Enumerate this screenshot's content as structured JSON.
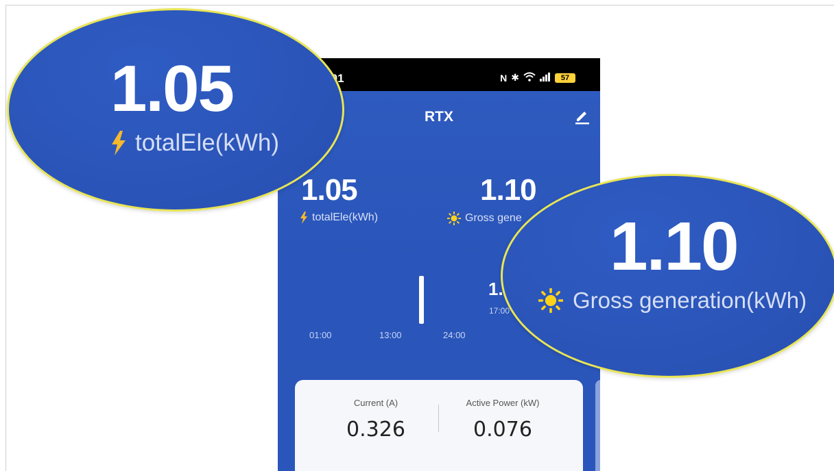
{
  "status_bar": {
    "time": ":01",
    "battery": "57"
  },
  "header": {
    "title": "RTX"
  },
  "stats": {
    "total_ele": {
      "value": "1.05",
      "label": "totalEle(kWh)"
    },
    "gross_generation": {
      "value": "1.10",
      "label_partial": "Gross gene",
      "label_full": "Gross generation(kWh)"
    }
  },
  "chart": {
    "x_labels": [
      "01:00",
      "13:00",
      "24:00"
    ],
    "tooltip": {
      "value": "1.",
      "time": "17:00"
    }
  },
  "card": {
    "current": {
      "label": "Current (A)",
      "value": "0.326"
    },
    "active_power": {
      "label": "Active Power (kW)",
      "value": "0.076"
    }
  },
  "icons": {
    "bolt": "lightning-icon",
    "sun": "sun-icon",
    "edit": "pencil-icon"
  },
  "colors": {
    "primary": "#2a55ba",
    "bolt": "#f5b82e",
    "sun": "#ffd21a",
    "zoom_border": "#e8e556"
  }
}
